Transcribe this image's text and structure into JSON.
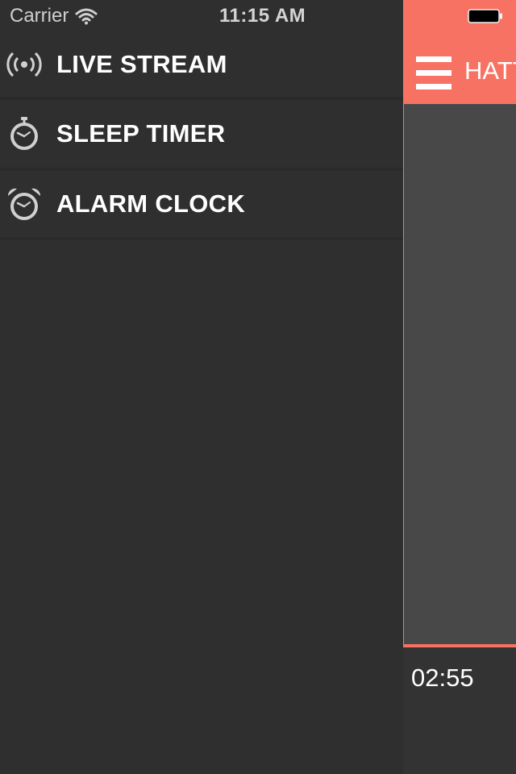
{
  "status_bar": {
    "carrier": "Carrier",
    "time": "11:15 AM",
    "icons": [
      "wifi-icon",
      "battery-icon"
    ]
  },
  "side_menu": {
    "items": [
      {
        "label": "LIVE STREAM",
        "icon": "broadcast-icon"
      },
      {
        "label": "SLEEP TIMER",
        "icon": "stopwatch-icon"
      },
      {
        "label": "ALARM CLOCK",
        "icon": "alarm-clock-icon"
      }
    ]
  },
  "main": {
    "nav_title": "HATTRICK",
    "elapsed_time": "02:55"
  },
  "colors": {
    "accent": "#f77262",
    "menu_background": "#2f2f2f",
    "content_background": "#484848",
    "text": "#ffffff"
  }
}
